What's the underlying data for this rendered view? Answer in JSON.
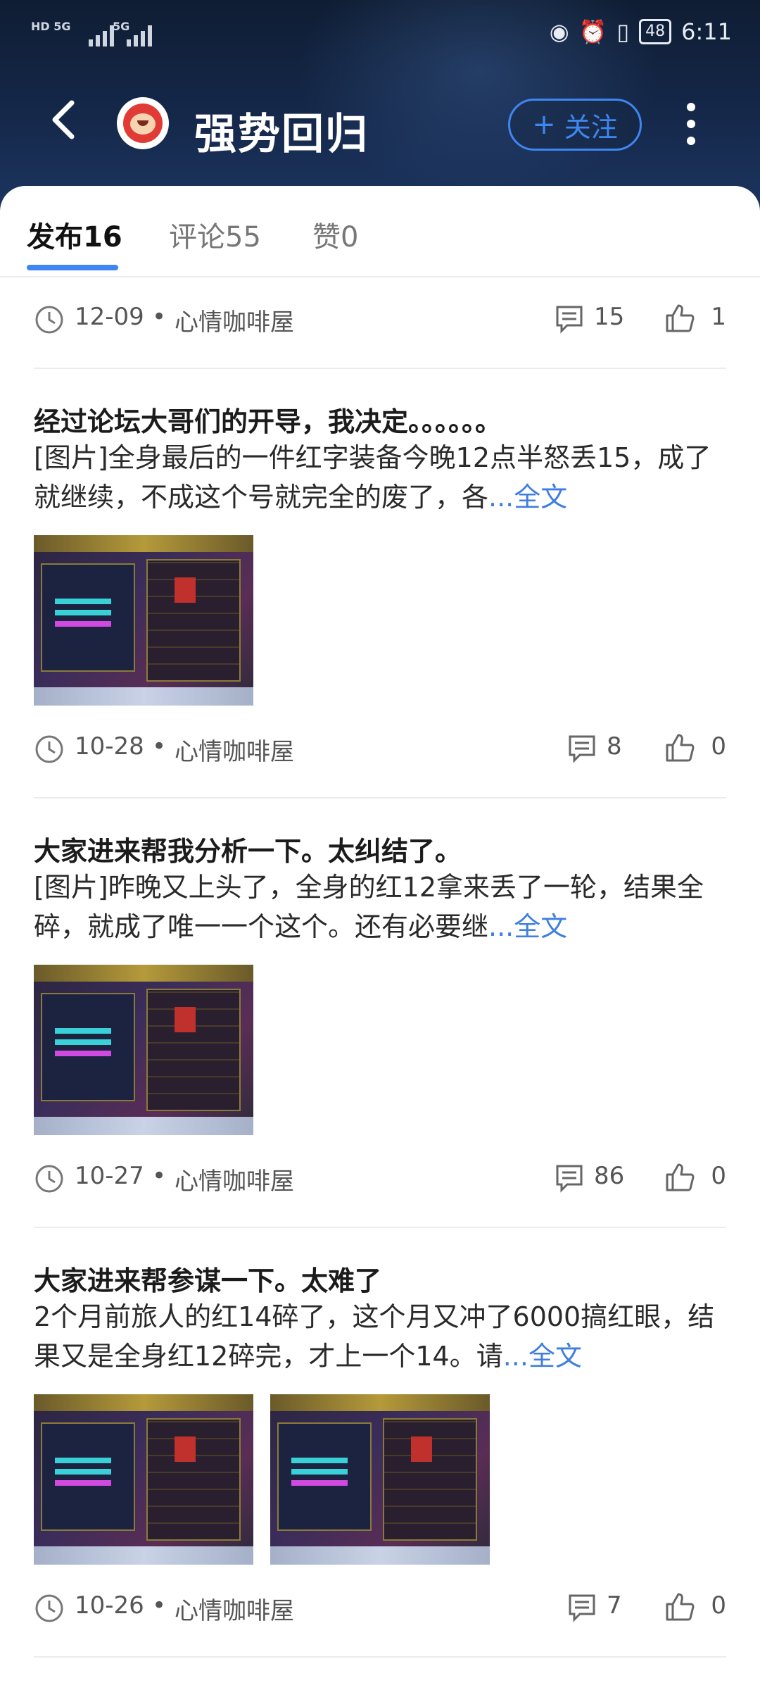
{
  "status_bar": {
    "signal1": "HD 5G",
    "signal2": "5G",
    "battery": "48",
    "time": "6:11"
  },
  "header": {
    "title": "强势回归",
    "follow_label": "关注",
    "follow_plus": "+"
  },
  "tabs": [
    {
      "label": "发布16",
      "active": true
    },
    {
      "label": "评论55",
      "active": false
    },
    {
      "label": "赞0",
      "active": false
    }
  ],
  "top_meta": {
    "date": "12-09",
    "forum": "心情咖啡屋",
    "comments": "15",
    "likes": "1"
  },
  "posts": [
    {
      "title": "经过论坛大哥们的开导，我决定。。。。。。",
      "body": "[图片]全身最后的一件红字装备今晚12点半怒丢15，成了就继续，不成这个号就完全的废了，各",
      "more": "...全文",
      "date": "10-28",
      "forum": "心情咖啡屋",
      "comments": "8",
      "likes": "0"
    },
    {
      "title": "大家进来帮我分析一下。太纠结了。",
      "body": "[图片]昨晚又上头了，全身的红12拿来丢了一轮，结果全碎，就成了唯一一个这个。还有必要继",
      "more": "...全文",
      "date": "10-27",
      "forum": "心情咖啡屋",
      "comments": "86",
      "likes": "0"
    },
    {
      "title": "大家进来帮参谋一下。太难了",
      "body": "2个月前旅人的红14碎了，这个月又冲了6000搞红眼，结果又是全身红12碎完，才上一个14。请",
      "more": "...全文",
      "date": "10-26",
      "forum": "心情咖啡屋",
      "comments": "7",
      "likes": "0"
    }
  ],
  "separator": "•",
  "colors": {
    "accent": "#3f86f0",
    "header_bg": "#15284a",
    "link": "#3f7ee0"
  }
}
